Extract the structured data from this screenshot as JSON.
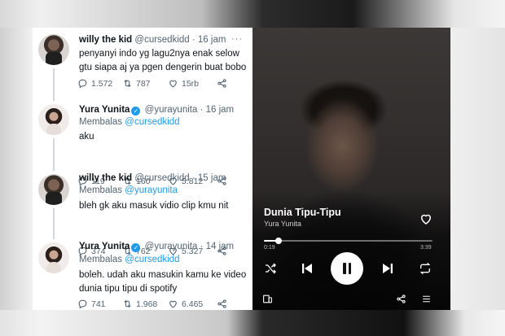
{
  "tweets": [
    {
      "name": "willy the kid",
      "handle": "@cursedkidd",
      "time": "· 16 jam",
      "verified": false,
      "reply_label": "",
      "reply_to": "",
      "text": [
        "penyanyi indo yg lagu2nya enak selow",
        "gtu siapa aj ya pgen dengerin buat bobo"
      ],
      "replies": "1.572",
      "retweets": "787",
      "likes": "15rb"
    },
    {
      "name": "Yura Yunita",
      "handle": "@yurayunita",
      "time": "· 16 jam",
      "verified": true,
      "reply_label": "Membalas",
      "reply_to": "@cursedkidd",
      "text": [
        "aku"
      ],
      "replies": "119",
      "retweets": "160",
      "likes": "5.812"
    },
    {
      "name": "willy the kid",
      "handle": "@cursedkidd",
      "time": "· 15 jam",
      "verified": false,
      "reply_label": "Membalas",
      "reply_to": "@yurayunita",
      "text": [
        "bleh gk aku masuk vidio clip kmu nit"
      ],
      "replies": "374",
      "retweets": "762",
      "likes": "5.327"
    },
    {
      "name": "Yura Yunita",
      "handle": "@yurayunita",
      "time": "· 14 jam",
      "verified": true,
      "reply_label": "Membalas",
      "reply_to": "@cursedkidd",
      "text": [
        "boleh. udah aku masukin kamu ke video",
        "dunia tipu tipu di spotify"
      ],
      "replies": "741",
      "retweets": "1.968",
      "likes": "6.465"
    }
  ],
  "player": {
    "song_title": "Dunia Tipu-Tipu",
    "artist": "Yura Yunita",
    "time_elapsed": "0:19",
    "time_total": "3:39",
    "progress_fraction": 0.087,
    "liked": false
  },
  "icons": {
    "reply": "reply-icon",
    "retweet": "retweet-icon",
    "like": "heart-icon",
    "share": "share-icon",
    "more": "more-icon",
    "verified": "verified-badge-icon",
    "shuffle": "shuffle-icon",
    "previous": "skip-previous-icon",
    "pause": "pause-icon",
    "next": "skip-next-icon",
    "repeat": "repeat-icon",
    "devices": "devices-icon",
    "queue": "queue-icon"
  },
  "colors": {
    "twitter_link": "#1d9bf0",
    "twitter_text": "#0f1419",
    "twitter_muted": "#536471"
  }
}
